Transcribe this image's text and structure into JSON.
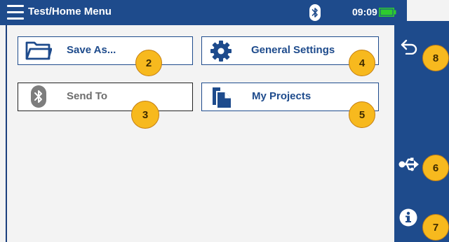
{
  "header": {
    "title": "Test/Home Menu",
    "time": "09:09",
    "menu_icon": "hamburger-icon",
    "bluetooth_icon": "bluetooth-icon",
    "battery_icon": "battery-icon",
    "battery_level": 1.0
  },
  "tiles": [
    {
      "label": "Save As...",
      "icon": "folder-icon",
      "callout": "2",
      "enabled": true
    },
    {
      "label": "General Settings",
      "icon": "gear-icon",
      "callout": "4",
      "enabled": true
    },
    {
      "label": "Send To",
      "icon": "bluetooth-icon",
      "callout": "3",
      "enabled": false
    },
    {
      "label": "My Projects",
      "icon": "projects-icon",
      "callout": "5",
      "enabled": true
    }
  ],
  "side_panel": {
    "back": {
      "icon": "back-arrow-icon",
      "callout": "8"
    },
    "usb": {
      "icon": "usb-icon",
      "callout": "6"
    },
    "info": {
      "icon": "info-icon",
      "callout": "7"
    }
  },
  "colors": {
    "brand_blue": "#1e4b8c",
    "callout_orange": "#f7b91e",
    "battery_green": "#2ecc2e",
    "background": "#f3f3f3"
  }
}
